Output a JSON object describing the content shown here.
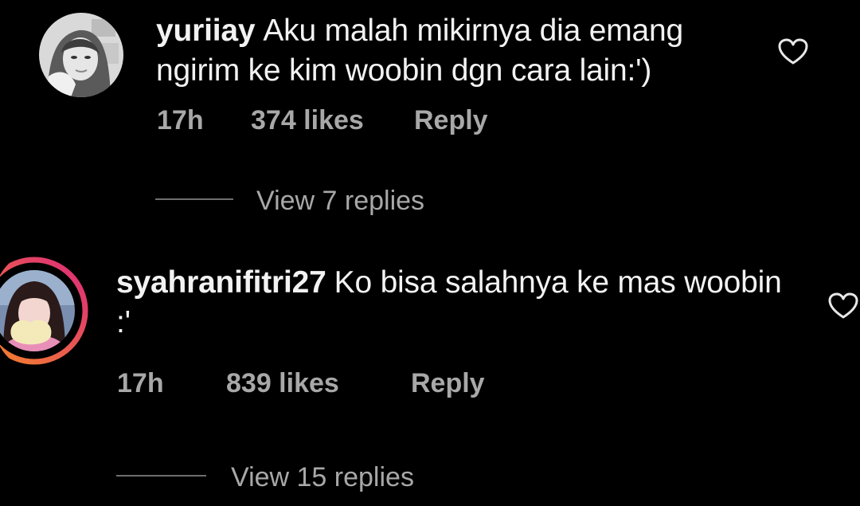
{
  "comments": [
    {
      "username": "yuriiay",
      "text": "Aku malah mikirnya dia emang ngirim ke kim woobin dgn cara lain:')",
      "time": "17h",
      "likes": "374 likes",
      "reply_label": "Reply",
      "view_replies": "View 7 replies",
      "has_story_ring": false
    },
    {
      "username": "syahranifitri27",
      "text": "Ko bisa salahnya ke mas woobin :'",
      "time": "17h",
      "likes": "839 likes",
      "reply_label": "Reply",
      "view_replies": "View 15 replies",
      "has_story_ring": true
    }
  ],
  "icons": {
    "like": "heart-outline-icon"
  },
  "colors": {
    "background": "#000000",
    "text": "#f2f2f2",
    "muted": "#a8a8a8",
    "story_ring_start": "#f58529",
    "story_ring_end": "#dd2a7b"
  }
}
